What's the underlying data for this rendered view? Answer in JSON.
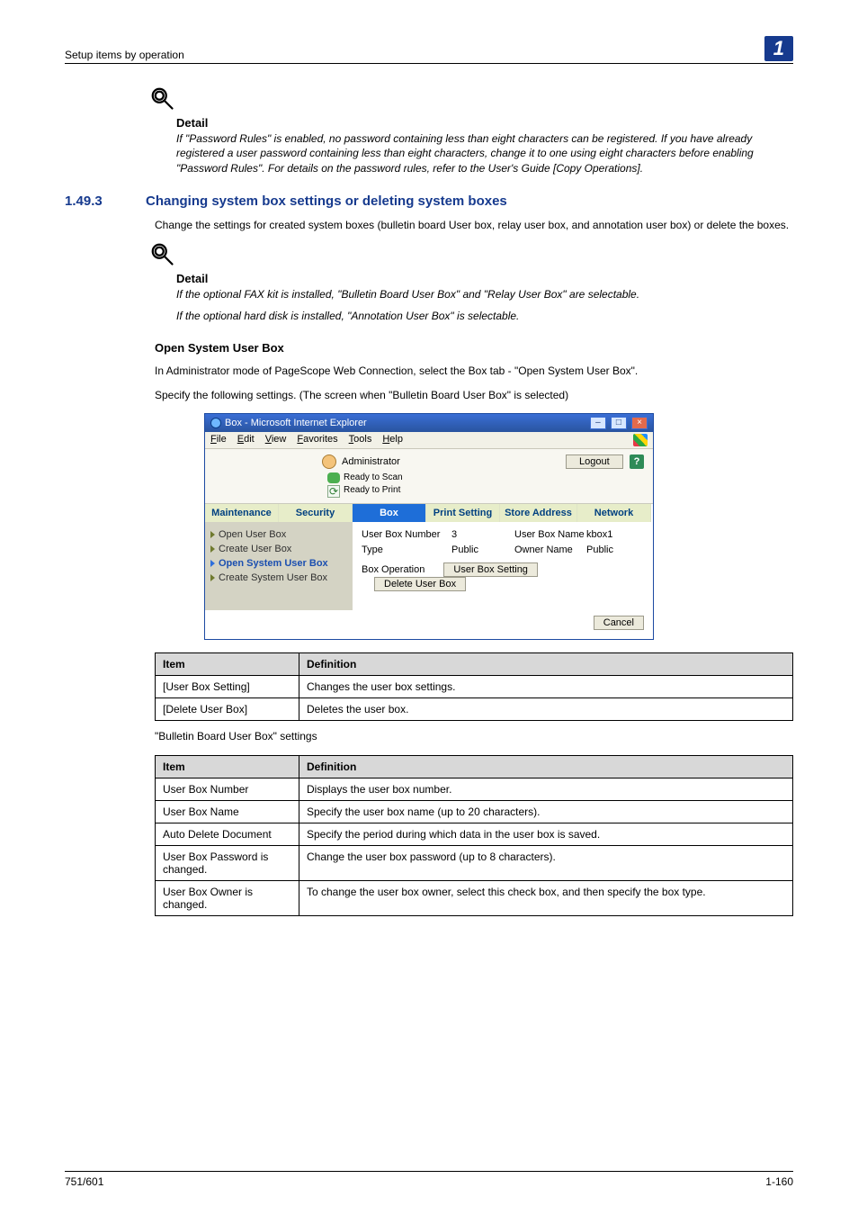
{
  "header": {
    "left": "Setup items by operation",
    "chapter": "1"
  },
  "footer": {
    "left": "751/601",
    "right": "1-160"
  },
  "note1": {
    "title": "Detail",
    "body": "If \"Password Rules\" is enabled, no password containing less than eight characters can be registered. If you have already registered a user password containing less than eight characters, change it to one using eight characters before enabling \"Password Rules\". For details on the password rules, refer to the User's Guide [Copy Operations]."
  },
  "section": {
    "num": "1.49.3",
    "title": "Changing system box settings or deleting system boxes",
    "intro": "Change the settings for created system boxes (bulletin board User box, relay user box, and annotation user box) or delete the boxes."
  },
  "note2": {
    "title": "Detail",
    "line1": "If the optional FAX kit is installed, \"Bulletin Board User Box\" and \"Relay User Box\" are selectable.",
    "line2": "If the optional hard disk is installed, \"Annotation User Box\" is selectable."
  },
  "subheading": "Open System User Box",
  "para1": "In Administrator mode of PageScope Web Connection, select the Box tab - \"Open System User Box\".",
  "para2": "Specify the following settings. (The screen when \"Bulletin Board User Box\" is selected)",
  "screenshot": {
    "windowTitle": "Box - Microsoft Internet Explorer",
    "menus": [
      "File",
      "Edit",
      "View",
      "Favorites",
      "Tools",
      "Help"
    ],
    "admin": "Administrator",
    "logout": "Logout",
    "status1": "Ready to Scan",
    "status2": "Ready to Print",
    "tabs": [
      "Maintenance",
      "Security",
      "Box",
      "Print Setting",
      "Store Address",
      "Network"
    ],
    "activeTab": "Box",
    "side": {
      "open": "Open User Box",
      "create": "Create User Box",
      "openSys": "Open System User Box",
      "createSys": "Create System User Box"
    },
    "main": {
      "label_userboxnumber": "User Box Number",
      "val_userboxnumber": "3",
      "label_userboxname": "User Box Name",
      "val_userboxname": "kbox1",
      "label_type": "Type",
      "val_type": "Public",
      "label_ownername": "Owner Name",
      "val_ownername": "Public",
      "label_boxop": "Box Operation",
      "btn_setting": "User Box Setting",
      "btn_delete": "Delete User Box",
      "btn_cancel": "Cancel"
    }
  },
  "table1": {
    "header_item": "Item",
    "header_def": "Definition",
    "rows": [
      {
        "item": "[User Box Setting]",
        "def": "Changes the user box settings."
      },
      {
        "item": "[Delete User Box]",
        "def": "Deletes the user box."
      }
    ]
  },
  "caption2": "\"Bulletin Board User Box\" settings",
  "table2": {
    "header_item": "Item",
    "header_def": "Definition",
    "rows": [
      {
        "item": "User Box Number",
        "def": "Displays the user box number."
      },
      {
        "item": "User Box Name",
        "def": "Specify the user box name (up to 20 characters)."
      },
      {
        "item": "Auto Delete Document",
        "def": "Specify the period during which data in the user box is saved."
      },
      {
        "item": "User Box Password is changed.",
        "def": "Change the user box password (up to 8 characters)."
      },
      {
        "item": "User Box Owner is changed.",
        "def": "To change the user box owner, select this check box, and then specify the box type."
      }
    ]
  }
}
